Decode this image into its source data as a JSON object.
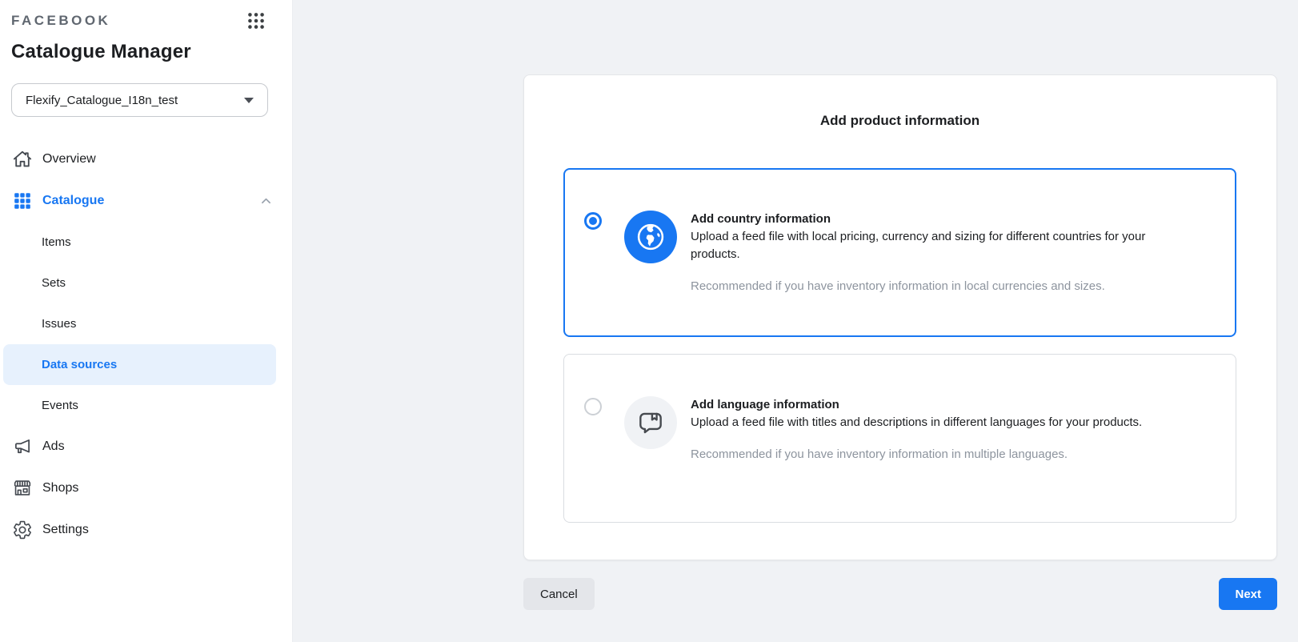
{
  "header": {
    "logo": "FACEBOOK",
    "app_title": "Catalogue Manager",
    "catalogue_selector": {
      "value": "Flexify_Catalogue_I18n_test",
      "caret_icon": "caret-down-icon"
    },
    "apps_icon": "apps-grid-icon"
  },
  "sidebar": {
    "items": [
      {
        "label": "Overview",
        "icon": "home-icon"
      },
      {
        "label": "Catalogue",
        "icon": "grid-icon",
        "expanded": true,
        "active": true,
        "chevron_icon": "chevron-up-icon"
      },
      {
        "label": "Ads",
        "icon": "megaphone-icon"
      },
      {
        "label": "Shops",
        "icon": "storefront-icon"
      },
      {
        "label": "Settings",
        "icon": "gear-icon"
      }
    ],
    "catalogue_children": [
      {
        "label": "Items",
        "selected": false
      },
      {
        "label": "Sets",
        "selected": false
      },
      {
        "label": "Issues",
        "selected": false
      },
      {
        "label": "Data sources",
        "selected": true
      },
      {
        "label": "Events",
        "selected": false
      }
    ]
  },
  "main": {
    "heading": "Add product information",
    "options": [
      {
        "title": "Add country information",
        "description": "Upload a feed file with local pricing, currency and sizing for different countries for your products.",
        "recommendation": "Recommended if you have inventory information in local currencies and sizes.",
        "selected": true,
        "icon": "globe-icon"
      },
      {
        "title": "Add language information",
        "description": "Upload a feed file with titles and descriptions in different languages for your products.",
        "recommendation": "Recommended if you have inventory information in multiple languages.",
        "selected": false,
        "icon": "speech-bubble-bookmark-icon"
      }
    ],
    "footer": {
      "cancel_label": "Cancel",
      "next_label": "Next"
    }
  },
  "colors": {
    "accent_blue": "#1877F2",
    "selected_item_bg": "#E7F1FD",
    "page_bg": "#F0F2F5",
    "muted_text": "#8D949E",
    "icon_gray": "#444950"
  }
}
